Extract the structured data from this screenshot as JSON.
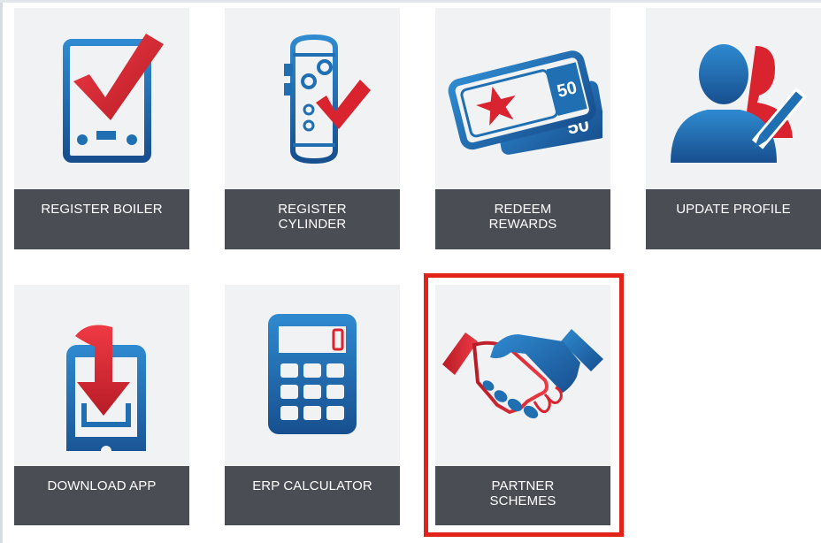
{
  "tiles": [
    {
      "label": "REGISTER BOILER",
      "icon": "boiler-check-icon"
    },
    {
      "label": "REGISTER\nCYLINDER",
      "icon": "cylinder-check-icon"
    },
    {
      "label": "REDEEM\nREWARDS",
      "icon": "reward-vouchers-icon"
    },
    {
      "label": "UPDATE PROFILE",
      "icon": "user-profile-edit-icon"
    },
    {
      "label": "DOWNLOAD APP",
      "icon": "phone-download-icon"
    },
    {
      "label": "ERP CALCULATOR",
      "icon": "calculator-icon"
    },
    {
      "label": "PARTNER\nSCHEMES",
      "icon": "handshake-icon"
    }
  ],
  "voucher_values": {
    "front": "50",
    "back": "50"
  },
  "colors": {
    "blue": "#1f6fb2",
    "red": "#d9232e",
    "tile_bg": "#f1f2f3",
    "label_bg": "#4a4d53",
    "highlight": "#e2231a"
  },
  "highlighted_tile": "PARTNER SCHEMES"
}
